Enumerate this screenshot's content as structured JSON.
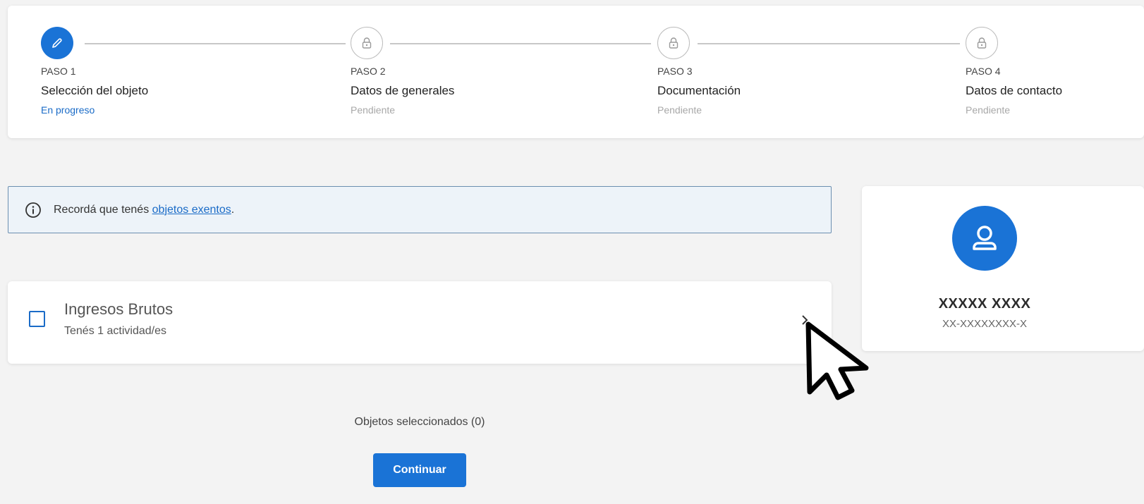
{
  "stepper": {
    "steps": [
      {
        "number": "PASO 1",
        "title": "Selección del objeto",
        "status": "En progreso",
        "state": "active",
        "icon": "pencil-icon"
      },
      {
        "number": "PASO 2",
        "title": "Datos de generales",
        "status": "Pendiente",
        "state": "locked",
        "icon": "lock-icon"
      },
      {
        "number": "PASO 3",
        "title": "Documentación",
        "status": "Pendiente",
        "state": "locked",
        "icon": "lock-icon"
      },
      {
        "number": "PASO 4",
        "title": "Datos de contacto",
        "status": "Pendiente",
        "state": "locked",
        "icon": "lock-icon"
      }
    ]
  },
  "banner": {
    "icon": "info-icon",
    "text": "Recordá que tenés ",
    "link": "objetos exentos",
    "suffix": "."
  },
  "object": {
    "title": "Ingresos Brutos",
    "subtitle": "Tenés 1 actividad/es",
    "checked": false,
    "icon": "chevron-right-icon"
  },
  "selection": {
    "count_label": "Objetos seleccionados (0)",
    "continue_label": "Continuar"
  },
  "user": {
    "name": "XXXXX XXXX",
    "id": "XX-XXXXXXXX-X",
    "icon": "user-icon"
  },
  "colors": {
    "accent": "#1a73d6",
    "link": "#1a6bc7",
    "banner_bg": "#edf3f9",
    "banner_border": "#6b8fb0",
    "page_bg": "#f3f3f3"
  }
}
